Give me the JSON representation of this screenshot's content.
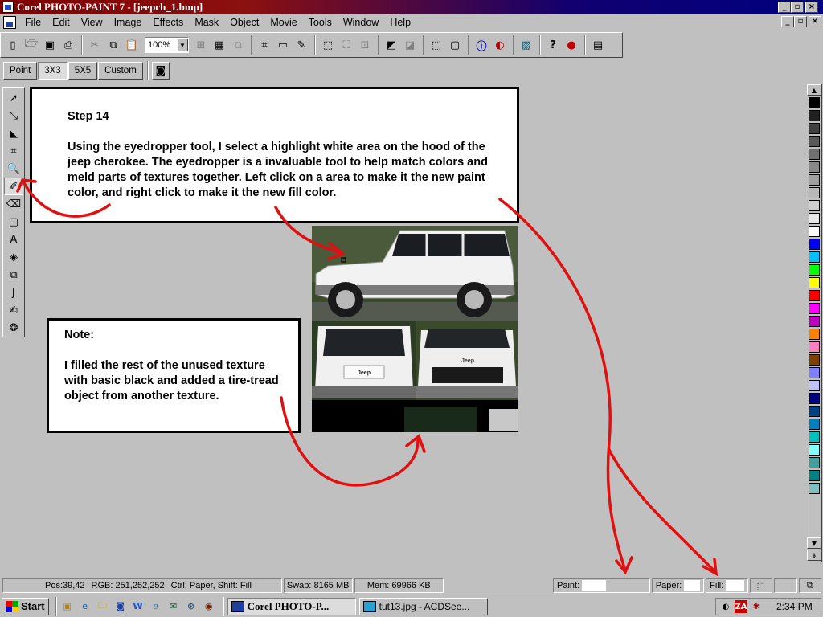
{
  "window": {
    "title": "Corel PHOTO-PAINT 7 - [jeepch_1.bmp]",
    "title_buttons": [
      "_",
      "▫",
      "×"
    ],
    "doc_buttons": [
      "_",
      "▫",
      "×"
    ]
  },
  "menu": [
    "File",
    "Edit",
    "View",
    "Image",
    "Effects",
    "Mask",
    "Object",
    "Movie",
    "Tools",
    "Window",
    "Help"
  ],
  "toolbar": {
    "zoom_value": "100%"
  },
  "brush_options": {
    "segments": [
      "Point",
      "3X3",
      "5X5",
      "Custom"
    ],
    "selected": "3X3"
  },
  "step_box": {
    "title": "Step 14",
    "body": "Using the eyedropper tool, I select a highlight white area on the hood of the jeep cherokee. The eyedropper is a invaluable tool to help match colors and meld parts of textures together. Left click on a area to make it the new paint color, and right click to make it the new fill color."
  },
  "note_box": {
    "title": "Note:",
    "body": "I filled the rest of the unused texture with basic black and added a tire-tread object from another texture."
  },
  "palette": {
    "colors": [
      "#000000",
      "#202020",
      "#404040",
      "#585858",
      "#707070",
      "#888888",
      "#a0a0a0",
      "#b8b8b8",
      "#d0d0d0",
      "#e8e8e8",
      "#ffffff",
      "#0000ff",
      "#00c0ff",
      "#00ff00",
      "#ffff00",
      "#ff0000",
      "#ff00ff",
      "#c000c0",
      "#ff8000",
      "#ff80c0",
      "#804000",
      "#8080ff",
      "#c0c0ff",
      "#000080",
      "#004080",
      "#0080c0",
      "#00c0c0",
      "#80ffff",
      "#40a0a0",
      "#008080",
      "#80c0c0"
    ]
  },
  "status": {
    "pos": "Pos:39,42",
    "rgb": "RGB: 251,252,252",
    "modifiers": "Ctrl: Paper, Shift: Fill",
    "swap": "Swap: 8165 MB",
    "mem": "Mem: 69966 KB",
    "paint_label": "Paint:",
    "paper_label": "Paper:",
    "fill_label": "Fill:"
  },
  "taskbar": {
    "start_label": "Start",
    "tasks": [
      {
        "label": "Corel PHOTO-P...",
        "active": true
      },
      {
        "label": "tut13.jpg - ACDSee...",
        "active": false
      }
    ],
    "clock": "2:34 PM"
  },
  "jeep_badge": "Jeep"
}
